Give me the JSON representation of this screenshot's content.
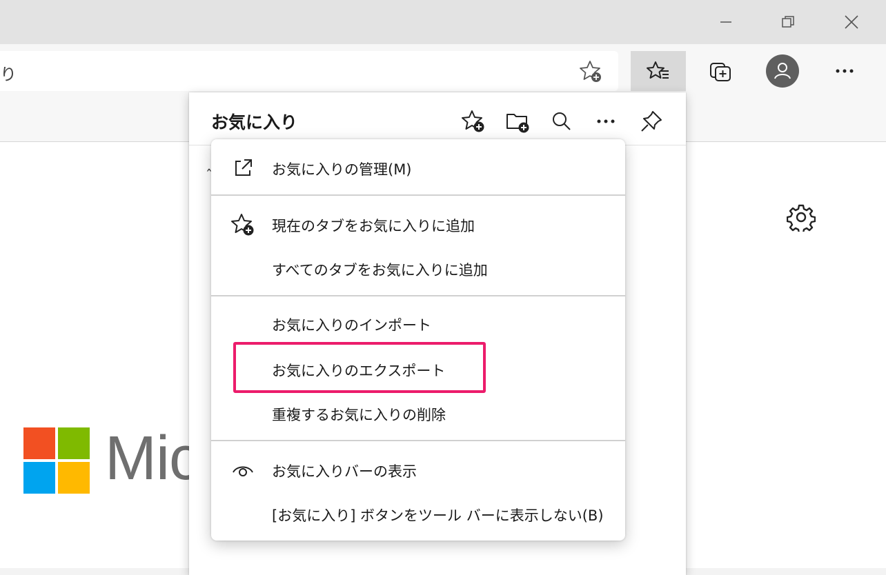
{
  "window": {
    "minimize_icon": "minimize-icon",
    "restore_icon": "restore-icon",
    "close_icon": "close-icon"
  },
  "address_bar": {
    "url_fragment": "り",
    "favorite_add_icon": "star-add-icon"
  },
  "toolbar": {
    "favorites_icon": "favorites-list-icon",
    "collections_icon": "collections-icon",
    "profile_icon": "profile-icon",
    "more_icon": "more-icon"
  },
  "favorites_panel": {
    "title": "お気に入り",
    "icons": [
      "star-add-icon",
      "folder-add-icon",
      "search-icon",
      "more-icon",
      "pin-icon"
    ]
  },
  "menu": {
    "manage": "お気に入りの管理(M)",
    "add_current_tab": "現在のタブをお気に入りに追加",
    "add_all_tabs": "すべてのタブをお気に入りに追加",
    "import": "お気に入りのインポート",
    "export": "お気に入りのエクスポート",
    "remove_duplicates": "重複するお気に入りの削除",
    "show_favorites_bar": "お気に入りバーの表示",
    "hide_button": "[お気に入り] ボタンをツール バーに表示しない(B)"
  },
  "page": {
    "brand_text": "Mic",
    "settings_icon": "gear-icon"
  },
  "colors": {
    "highlight": "#ec1c6b",
    "ms_red": "#f25022",
    "ms_green": "#7fba00",
    "ms_blue": "#00a4ef",
    "ms_yellow": "#ffb900"
  }
}
